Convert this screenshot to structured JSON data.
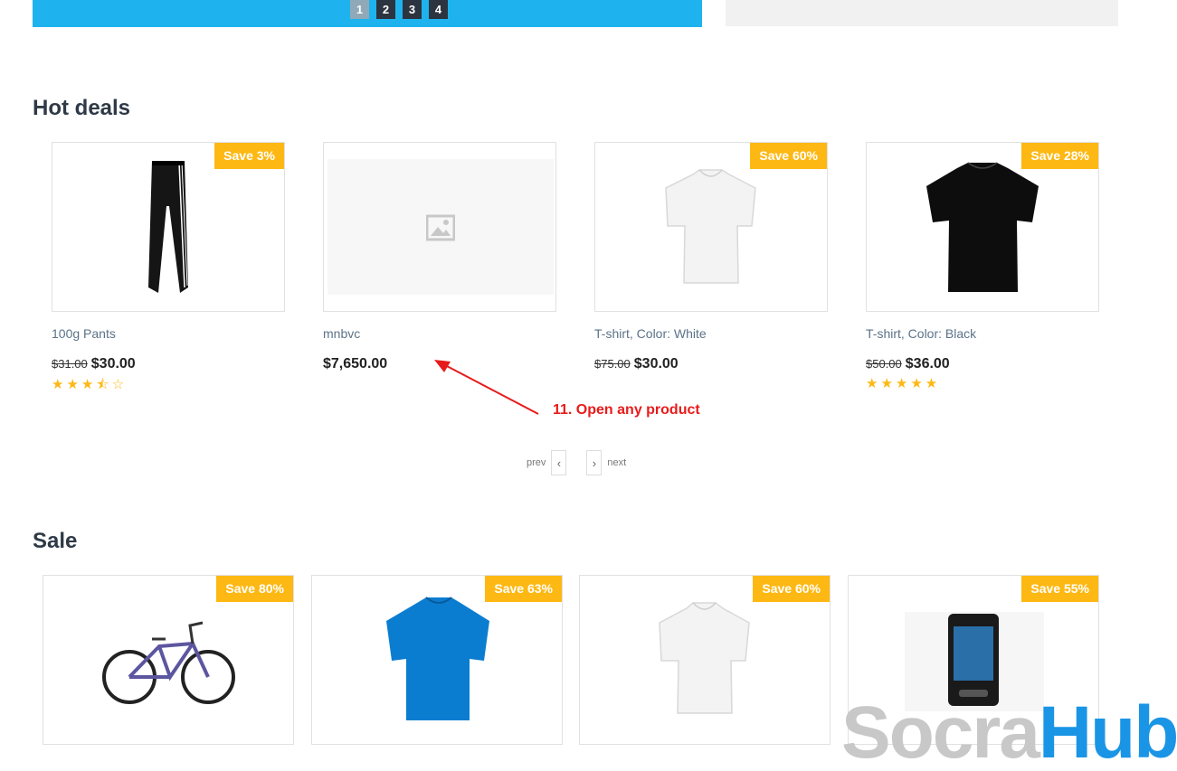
{
  "banner": {
    "slides": [
      "1",
      "2",
      "3",
      "4"
    ],
    "active_index": 0
  },
  "hot_deals": {
    "title": "Hot deals",
    "products": [
      {
        "name": "100g Pants",
        "old_price": "$31.00",
        "price": "$30.00",
        "badge": "Save 3%",
        "rating": 3.5,
        "image": "black-track-pants"
      },
      {
        "name": "mnbvc",
        "old_price": "",
        "price": "$7,650.00",
        "badge": "",
        "rating": 0,
        "image": "placeholder-image-icon"
      },
      {
        "name": "T-shirt, Color: White",
        "old_price": "$75.00",
        "price": "$30.00",
        "badge": "Save 60%",
        "rating": 0,
        "image": "white-tshirt"
      },
      {
        "name": "T-shirt, Color: Black",
        "old_price": "$50.00",
        "price": "$36.00",
        "badge": "Save 28%",
        "rating": 5,
        "image": "black-tshirt"
      }
    ],
    "pager": {
      "prev": "prev",
      "next": "next"
    }
  },
  "annotation": {
    "text": "11. Open any product",
    "color": "#e81b1b"
  },
  "sale": {
    "title": "Sale",
    "products": [
      {
        "badge": "Save 80%",
        "image": "bicycle"
      },
      {
        "badge": "Save 63%",
        "image": "blue-tshirt"
      },
      {
        "badge": "Save 60%",
        "image": "white-tshirt"
      },
      {
        "badge": "Save 55%",
        "image": "mp3-player"
      }
    ]
  },
  "watermark": {
    "part1": "Socra",
    "part2": "Hub"
  },
  "colors": {
    "accent_badge": "#fdb813",
    "banner_blue": "#1eb3ef",
    "heading": "#2f3a47"
  }
}
